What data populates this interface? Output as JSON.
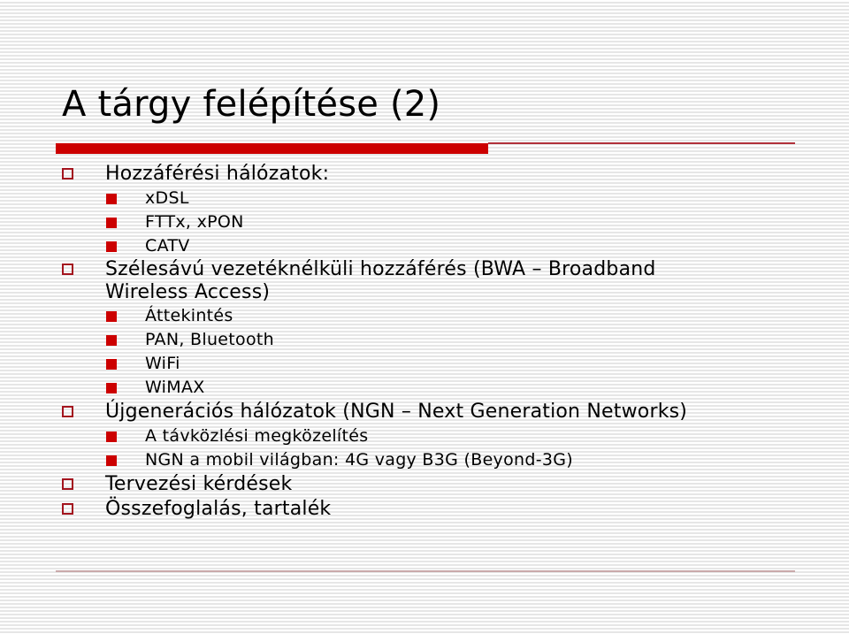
{
  "slide": {
    "title": "A tárgy felépítése (2)",
    "accent_color": "#cc0000",
    "outline": [
      {
        "label": "Hozzáférési hálózatok:",
        "children": [
          {
            "label": "xDSL"
          },
          {
            "label": "FTTx, xPON"
          },
          {
            "label": "CATV"
          }
        ]
      },
      {
        "label": "Szélesávú vezetéknélküli hozzáférés (BWA – Broadband Wireless Access)",
        "children": [
          {
            "label": "Áttekintés"
          },
          {
            "label": "PAN, Bluetooth"
          },
          {
            "label": "WiFi"
          },
          {
            "label": "WiMAX"
          }
        ]
      },
      {
        "label": "Újgenerációs hálózatok (NGN – Next Generation Networks)",
        "children": [
          {
            "label": "A távközlési megközelítés"
          },
          {
            "label": "NGN a mobil világban: 4G vagy B3G (Beyond-3G)"
          }
        ]
      },
      {
        "label": "Tervezési kérdések",
        "children": []
      },
      {
        "label": "Összefoglalás, tartalék",
        "children": []
      }
    ],
    "icons": {
      "level1_bullet": "hollow-square-bullet-icon",
      "level2_bullet": "filled-square-bullet-icon"
    }
  }
}
